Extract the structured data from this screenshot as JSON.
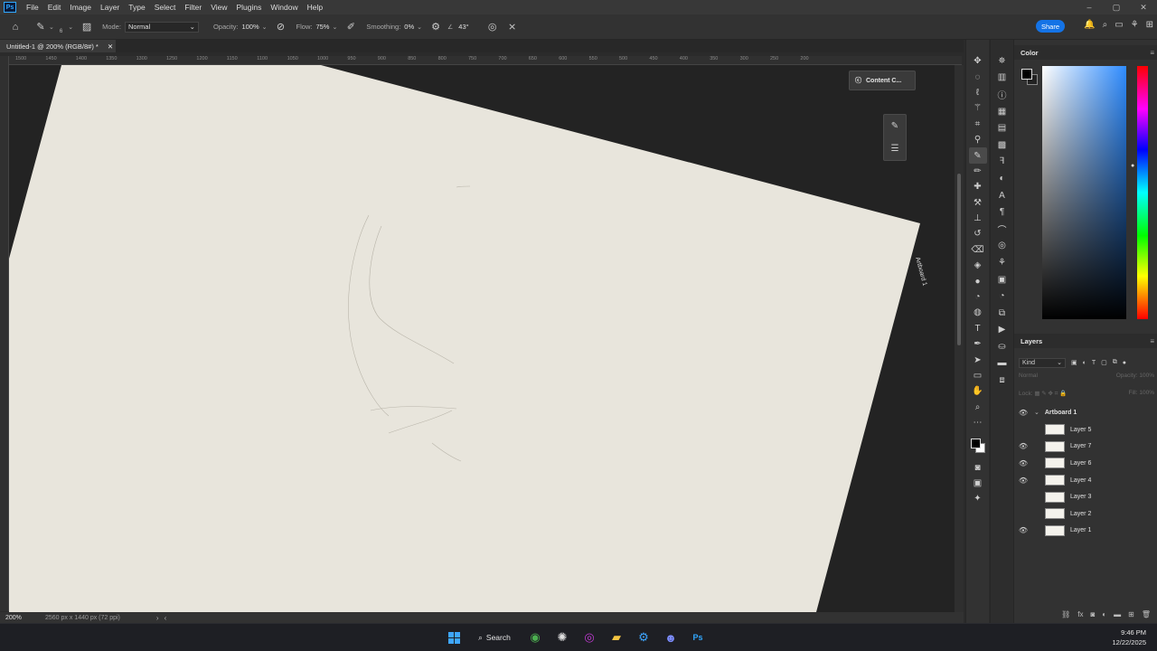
{
  "app": {
    "logo": "Ps",
    "menu": [
      "File",
      "Edit",
      "Image",
      "Layer",
      "Type",
      "Select",
      "Filter",
      "View",
      "Plugins",
      "Window",
      "Help"
    ]
  },
  "options": {
    "brush_size": "6",
    "mode_label": "Mode:",
    "mode_value": "Normal",
    "opacity_label": "Opacity:",
    "opacity_value": "100%",
    "flow_label": "Flow:",
    "flow_value": "75%",
    "smoothing_label": "Smoothing:",
    "smoothing_value": "0%",
    "angle_value": "43°",
    "share_label": "Share"
  },
  "document": {
    "tab_title": "Untitled-1 @ 200% (RGB/8#) *",
    "artboard_label": "Artboard 1",
    "content_button": "Content C...",
    "ruler_ticks": [
      "1500",
      "1450",
      "1400",
      "1350",
      "1300",
      "1250",
      "1200",
      "1150",
      "1100",
      "1050",
      "1000",
      "950",
      "900",
      "850",
      "800",
      "750",
      "700",
      "650",
      "600",
      "550",
      "500",
      "450",
      "400",
      "350",
      "300",
      "250",
      "200"
    ],
    "paper_color": "#e8e5dc"
  },
  "status": {
    "zoom": "200%",
    "info": "2560 px x 1440 px (72 ppi)"
  },
  "color_panel": {
    "title": "Color",
    "foreground": "#000000"
  },
  "layers_panel": {
    "title": "Layers",
    "filter_label": "Kind",
    "blend_mode": "Normal",
    "opacity_label": "Opacity:",
    "opacity_value": "100%",
    "lock_label": "Lock:",
    "fill_label": "Fill:",
    "fill_value": "100%",
    "group": "Artboard 1",
    "layers": [
      {
        "name": "Layer 5",
        "visible": false
      },
      {
        "name": "Layer 7",
        "visible": true
      },
      {
        "name": "Layer 6",
        "visible": true
      },
      {
        "name": "Layer 4",
        "visible": true
      },
      {
        "name": "Layer 3",
        "visible": false
      },
      {
        "name": "Layer 2",
        "visible": false
      },
      {
        "name": "Layer 1",
        "visible": true
      }
    ]
  },
  "taskbar": {
    "search_label": "Search",
    "time": "9:46 PM",
    "date": "12/22/2025"
  }
}
